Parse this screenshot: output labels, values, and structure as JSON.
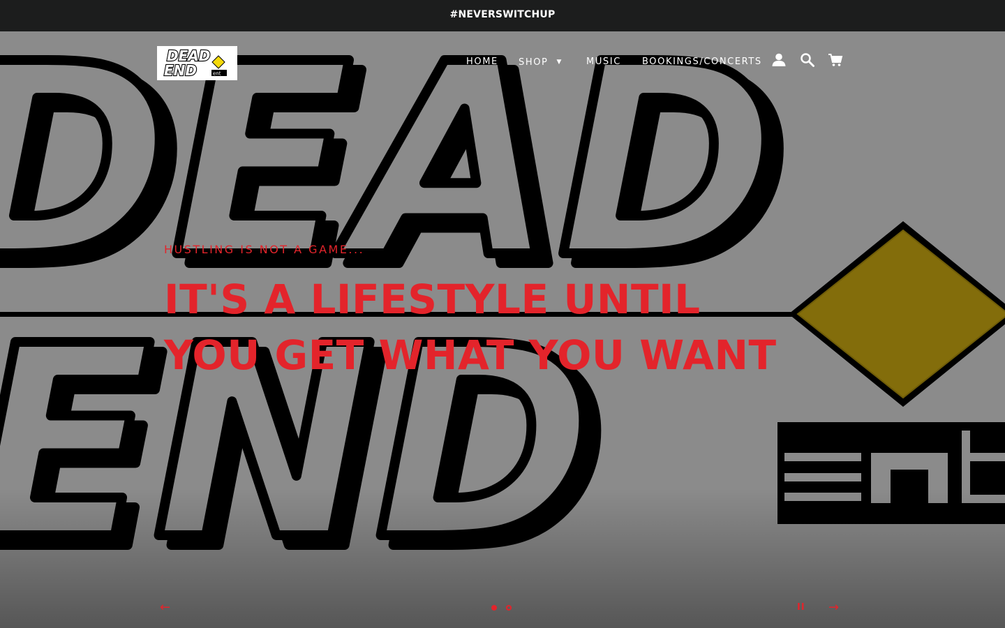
{
  "announcement": {
    "text": "#NEVERSWITCHUP"
  },
  "brand": {
    "logo_text_line1": "DEAD",
    "logo_text_line2": "END",
    "logo_text_suffix": "ent"
  },
  "nav": {
    "items": [
      {
        "label": "HOME"
      },
      {
        "label": "SHOP",
        "has_dropdown": true
      },
      {
        "label": "MUSIC"
      },
      {
        "label": "BOOKINGS/CONCERTS"
      }
    ],
    "icons": [
      "user-icon",
      "search-icon",
      "cart-icon"
    ]
  },
  "hero": {
    "subtitle": "HUSTLING IS NOT A GAME...",
    "title": "IT'S A LIFESTYLE UNTIL YOU GET WHAT YOU WANT",
    "background_word_top": "DEAD",
    "background_word_bottom": "END",
    "background_suffix": "ent"
  },
  "slideshow": {
    "prev_symbol": "←",
    "next_symbol": "→",
    "pause_symbol": "II",
    "slide_count": 2,
    "active_slide": 1
  },
  "colors": {
    "accent_red": "#e3242b",
    "announcement_bg": "#1c1d1d",
    "hero_bg": "#8b8b8b",
    "sign_yellow": "#836d0b"
  }
}
